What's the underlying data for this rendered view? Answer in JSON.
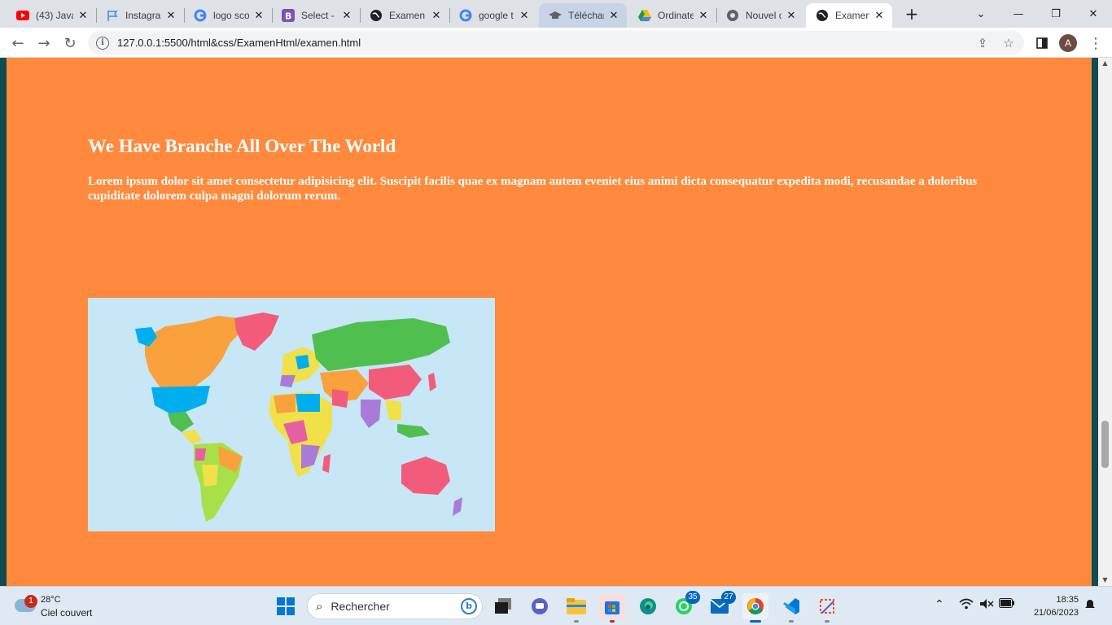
{
  "browser": {
    "tabs": [
      {
        "title": "(43) Java",
        "favicon": "youtube-icon",
        "color": "#ff0000"
      },
      {
        "title": "Instagra",
        "favicon": "flag-icon",
        "color": "#4285f4"
      },
      {
        "title": "logo sco",
        "favicon": "google-icon",
        "color": "#4285f4"
      },
      {
        "title": "Select - E",
        "favicon": "bootstrap-icon",
        "color": "#7952b3"
      },
      {
        "title": "Examen",
        "favicon": "globe-icon",
        "color": "#202124"
      },
      {
        "title": "google t",
        "favicon": "google-icon",
        "color": "#4285f4"
      },
      {
        "title": "Téléchar",
        "favicon": "graduation-cap-icon",
        "color": "#5f6368"
      },
      {
        "title": "Ordinate",
        "favicon": "google-drive-icon",
        "color": "#0f9d58"
      },
      {
        "title": "Nouvel o",
        "favicon": "chrome-icon",
        "color": "#5f6368"
      },
      {
        "title": "Examen",
        "favicon": "globe-icon",
        "color": "#202124",
        "active": true
      }
    ],
    "new_tab_label": "+",
    "address": "127.0.0.1:5500/html&css/ExamenHtml/examen.html",
    "profile_initial": "A"
  },
  "page": {
    "heading": "We Have Branche All Over The World",
    "paragraph": "Lorem ipsum dolor sit amet consectetur adipisicing elit. Suscipit facilis quae ex magnam autem eveniet eius animi dicta consequatur expedita modi, recusandae a doloribus cupiditate dolorem culpa magni dolorum rerum.",
    "background_color": "#ff8a3d",
    "image": "world-map-image"
  },
  "taskbar": {
    "weather": {
      "temp": "28°C",
      "condition": "Ciel couvert",
      "badge": "1"
    },
    "search_placeholder": "Rechercher",
    "apps": [
      {
        "name": "start-button",
        "color": "#0078d4"
      },
      {
        "name": "task-view-icon",
        "color": "#1b1b1b"
      },
      {
        "name": "teams-chat-icon",
        "color": "#5b5fc7"
      },
      {
        "name": "file-explorer-icon",
        "color": "#f8c33c"
      },
      {
        "name": "microsoft-store-icon",
        "color": "#1a73e8"
      },
      {
        "name": "edge-icon",
        "color": "#0c8f8b"
      },
      {
        "name": "whatsapp-icon",
        "color": "#25d366",
        "badge": "35"
      },
      {
        "name": "mail-icon",
        "color": "#0a6cbd",
        "badge": "27"
      },
      {
        "name": "chrome-icon",
        "color": "#db4437"
      },
      {
        "name": "vscode-icon",
        "color": "#0078d4"
      },
      {
        "name": "snipping-tool-icon",
        "color": "#e8562a"
      }
    ],
    "time": "18:35",
    "date": "21/06/2023"
  }
}
